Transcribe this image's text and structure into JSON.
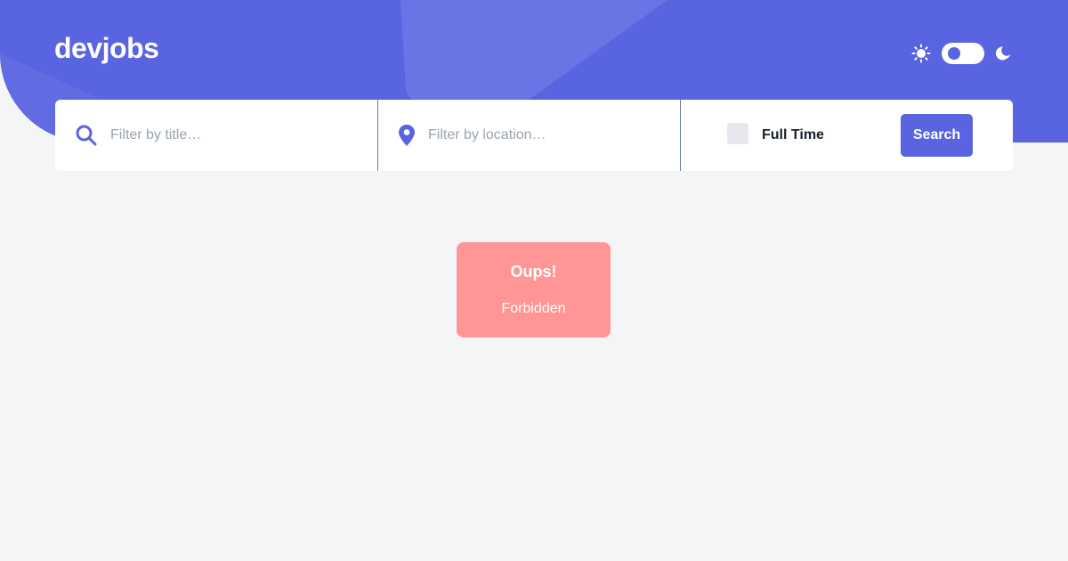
{
  "header": {
    "logo": "devjobs"
  },
  "theme_toggle": {
    "light_icon": "sun-icon",
    "dark_icon": "moon-icon",
    "mode": "light"
  },
  "search": {
    "title_placeholder": "Filter by title…",
    "title_value": "",
    "location_placeholder": "Filter by location…",
    "location_value": "",
    "fulltime_label": "Full Time",
    "fulltime_checked": false,
    "button_label": "Search"
  },
  "error": {
    "title": "Oups!",
    "message": "Forbidden"
  },
  "colors": {
    "brand": "#5964e0",
    "background": "#f4f5f7",
    "error_card": "#ff9695",
    "text_dark": "#19202d"
  }
}
